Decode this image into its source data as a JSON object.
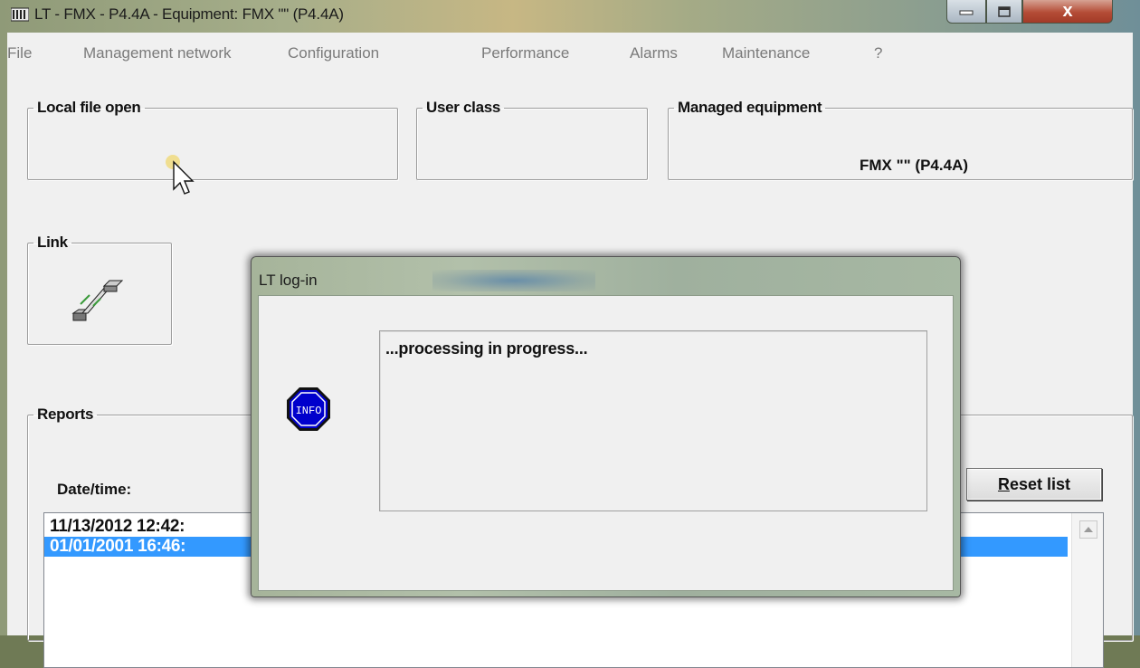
{
  "window": {
    "title": "LT - FMX - P4.4A - Equipment: FMX \"\" (P4.4A)",
    "close_glyph": "x",
    "icons": [
      "app-icon",
      "minimize-icon",
      "maximize-icon",
      "close-icon"
    ]
  },
  "menu": {
    "items": [
      "File",
      "Management network",
      "Configuration",
      "Performance",
      "Alarms",
      "Maintenance",
      "?"
    ]
  },
  "groups": {
    "local_file": {
      "label": "Local file open",
      "value": ""
    },
    "user_class": {
      "label": "User class",
      "value": ""
    },
    "managed_equipment": {
      "label": "Managed equipment",
      "value": "FMX \"\" (P4.4A)"
    },
    "link": {
      "label": "Link",
      "icon": "cable-link-icon"
    },
    "reports": {
      "label": "Reports"
    }
  },
  "reports": {
    "date_label": "Date/time:",
    "reset_button": {
      "mnemonic": "R",
      "rest": "eset list"
    },
    "rows": [
      {
        "text": "11/13/2012  12:42:",
        "selected": false
      },
      {
        "text": "01/01/2001  16:46:",
        "selected": true
      }
    ]
  },
  "dialog": {
    "title": "LT log-in",
    "icon": "info-stop-icon",
    "icon_text": "INFO",
    "message": "...processing in progress..."
  },
  "colors": {
    "selection": "#3399ff",
    "info_icon": "#0000cc",
    "close_button": "#b44c36"
  }
}
